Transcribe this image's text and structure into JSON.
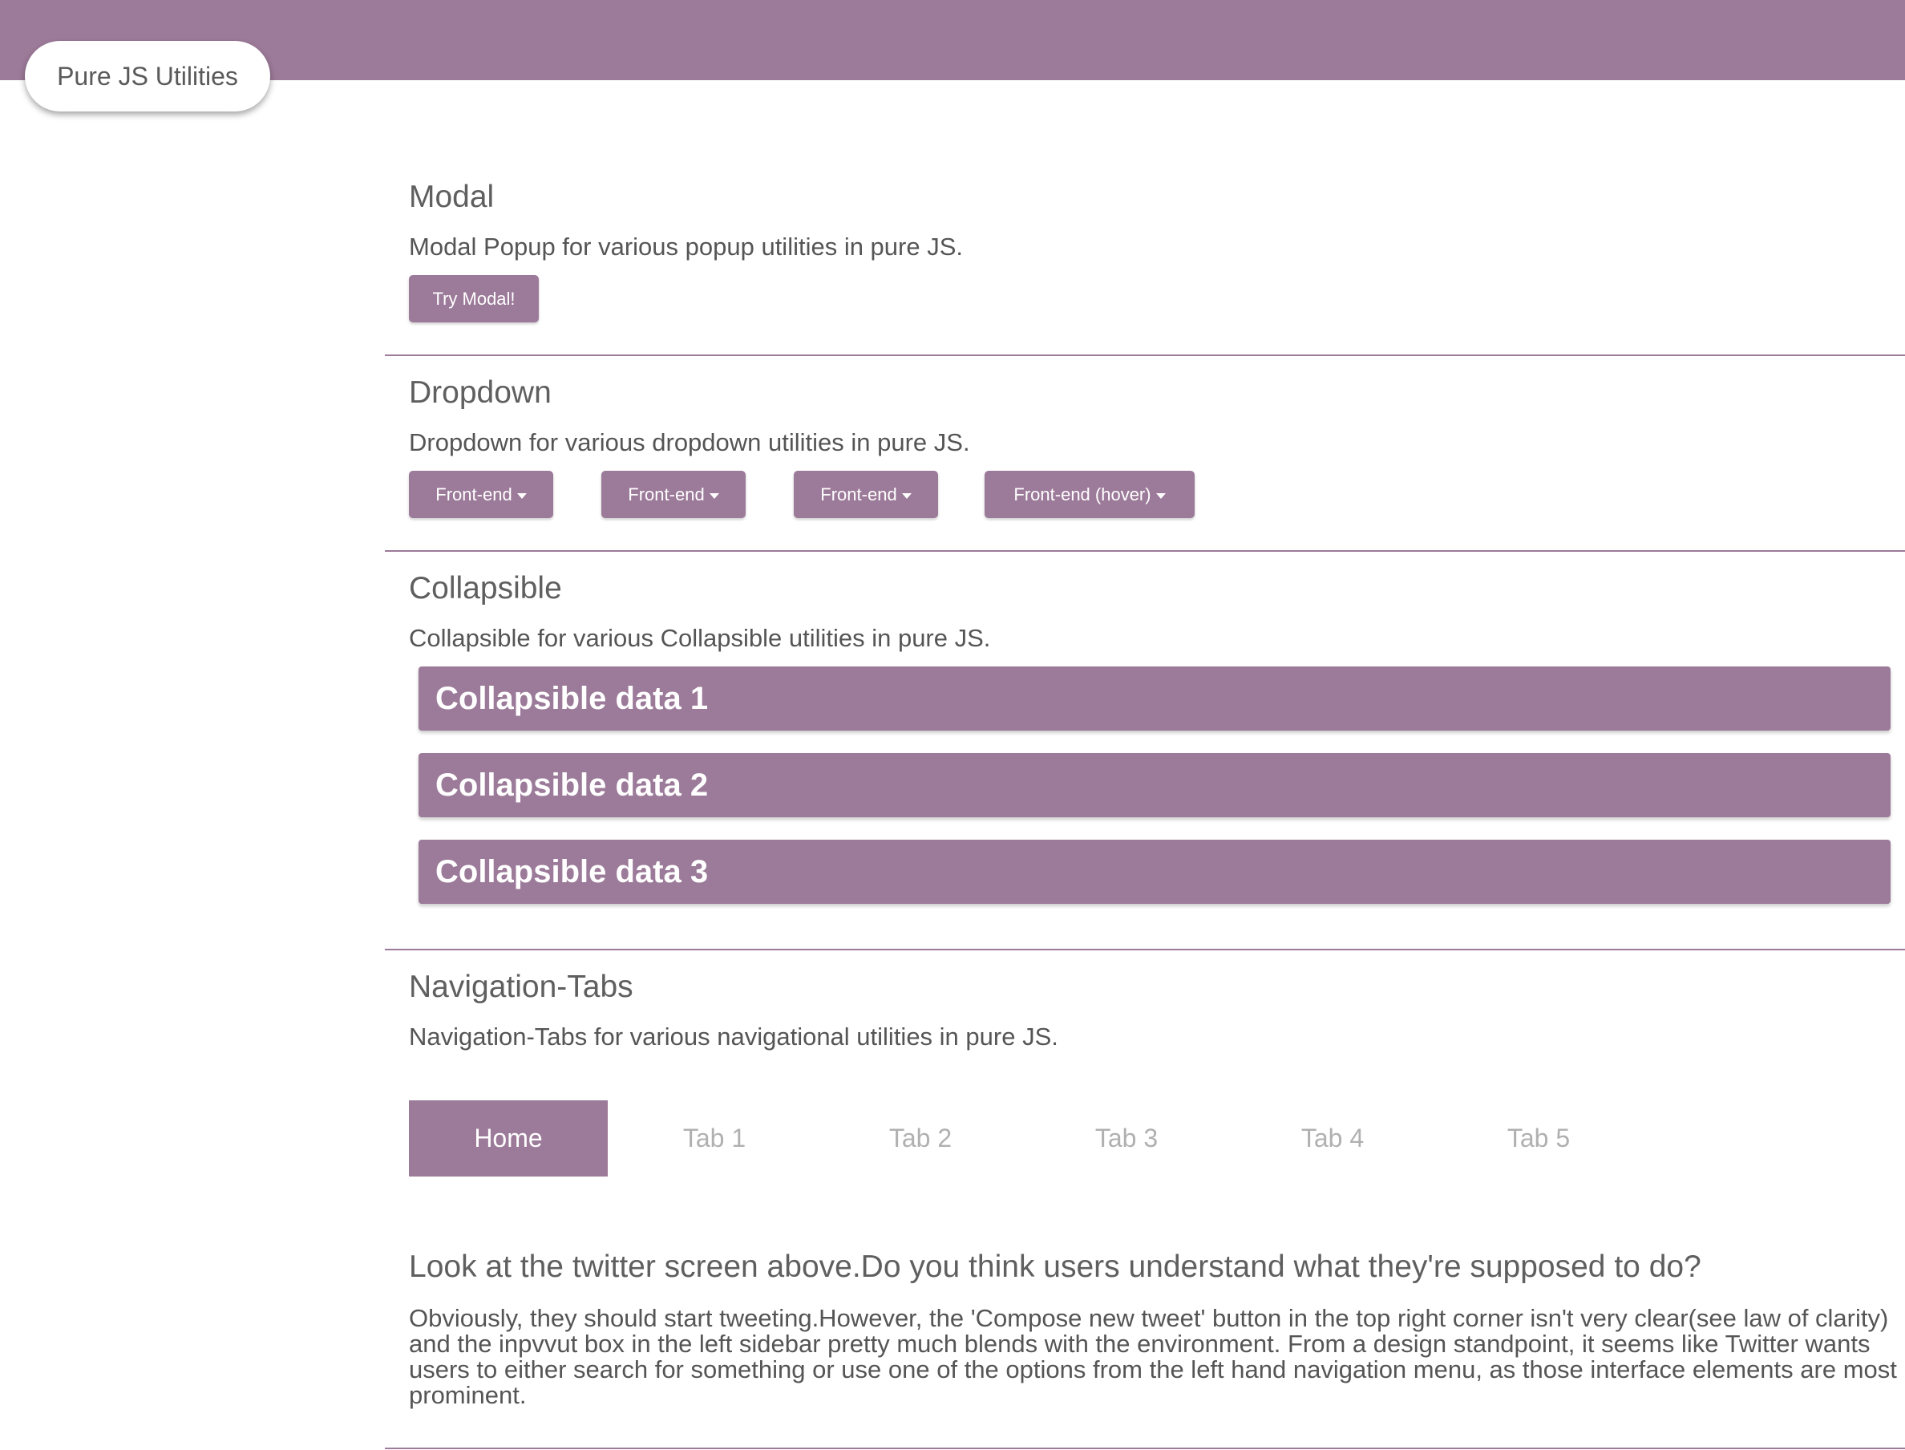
{
  "brand": {
    "label": "Pure JS Utilities"
  },
  "colors": {
    "accent": "#9c7a99",
    "text": "#5f5f5f",
    "tab_inactive": "#b0b0b0"
  },
  "modal": {
    "title": "Modal",
    "description": "Modal Popup for various popup utilities in pure JS.",
    "button_label": "Try Modal!"
  },
  "dropdown": {
    "title": "Dropdown",
    "description": "Dropdown for various dropdown utilities in pure JS.",
    "buttons": [
      {
        "label": "Front-end",
        "icon": "caret-down-icon"
      },
      {
        "label": "Front-end",
        "icon": "caret-down-icon"
      },
      {
        "label": "Front-end",
        "icon": "caret-down-icon"
      },
      {
        "label": "Front-end (hover)",
        "icon": "caret-down-icon"
      }
    ]
  },
  "collapsible": {
    "title": "Collapsible",
    "description": "Collapsible for various Collapsible utilities in pure JS.",
    "items": [
      {
        "label": "Collapsible data 1"
      },
      {
        "label": "Collapsible data 2"
      },
      {
        "label": "Collapsible data 3"
      }
    ]
  },
  "nav_tabs": {
    "title": "Navigation-Tabs",
    "description": "Navigation-Tabs for various navigational utilities in pure JS.",
    "active_index": 0,
    "tabs": [
      {
        "label": "Home"
      },
      {
        "label": "Tab 1"
      },
      {
        "label": "Tab 2"
      },
      {
        "label": "Tab 3"
      },
      {
        "label": "Tab 4"
      },
      {
        "label": "Tab 5"
      }
    ],
    "panel": {
      "heading": "Look at the twitter screen above.Do you think users understand what they're supposed to do?",
      "body": "Obviously, they should start tweeting.However, the 'Compose new tweet' button in the top right corner isn't very clear(see law of clarity) and the inpvvut box in the left sidebar pretty much blends with the environment. From a design standpoint, it seems like Twitter wants users to either search for something or use one of the options from the left hand navigation menu, as those interface elements are most prominent."
    }
  }
}
